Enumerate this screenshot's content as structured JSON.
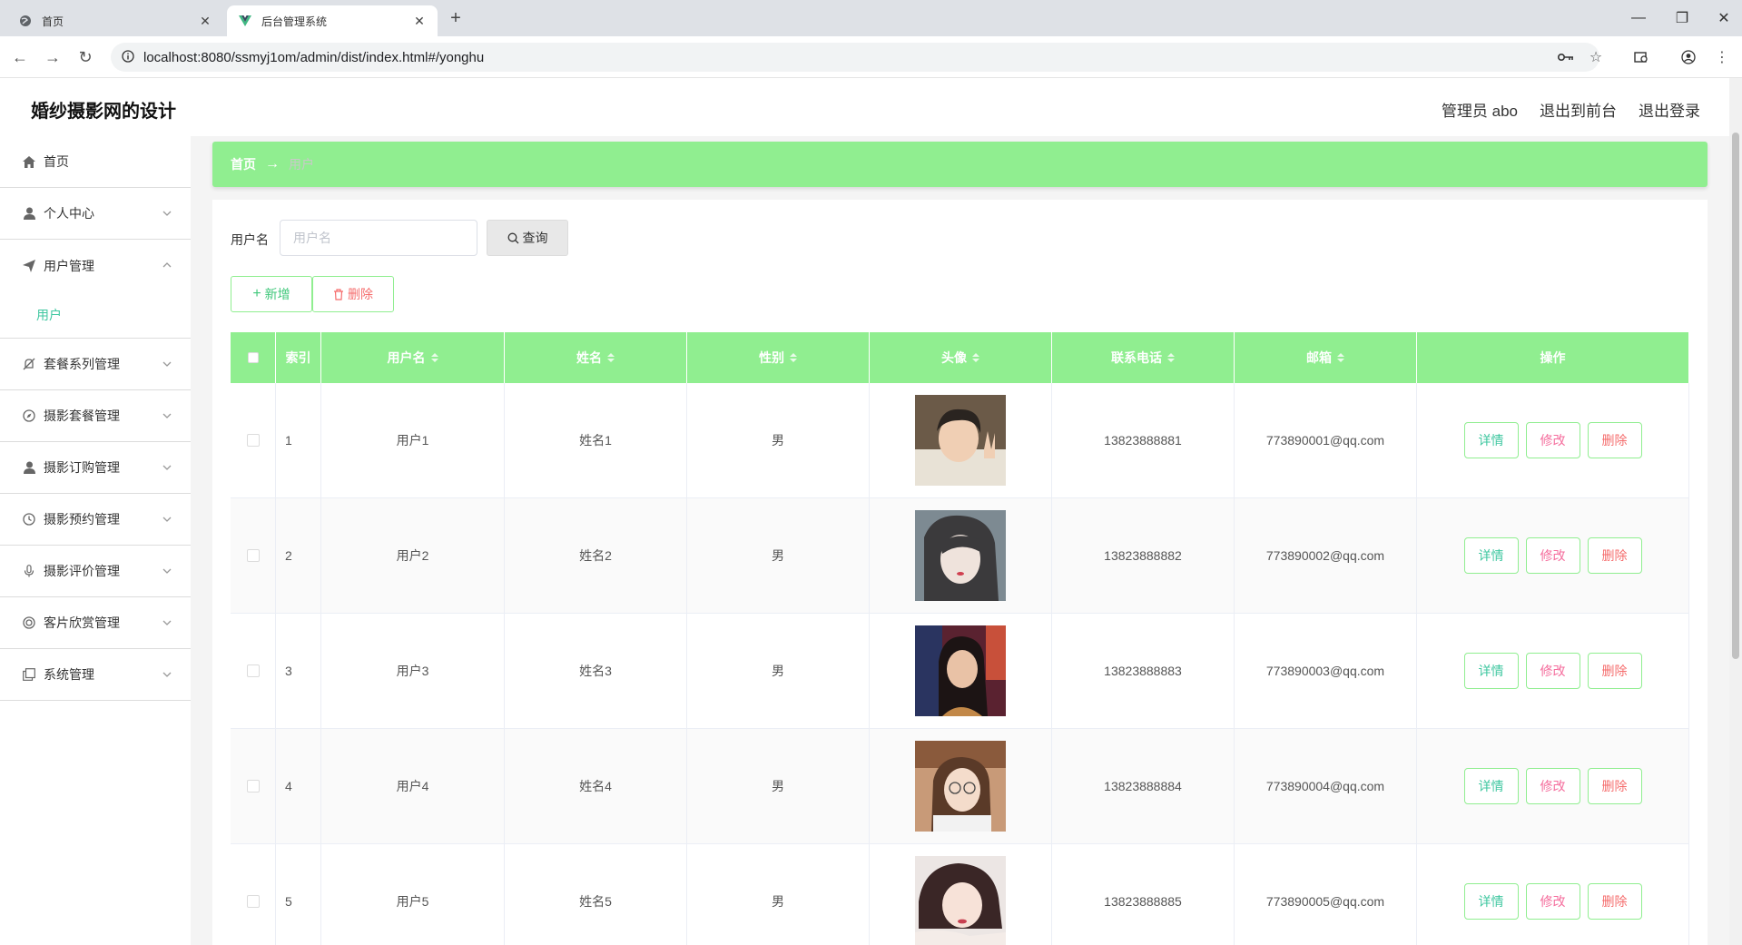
{
  "browser": {
    "tabs": [
      {
        "title": "首页",
        "active": false
      },
      {
        "title": "后台管理系统",
        "active": true
      }
    ],
    "url": "localhost:8080/ssmyj1om/admin/dist/index.html#/yonghu"
  },
  "header": {
    "title": "婚纱摄影网的设计",
    "links": [
      "管理员 abo",
      "退出到前台",
      "退出登录"
    ]
  },
  "sidebar": {
    "items": [
      {
        "label": "首页",
        "icon": "home-icon",
        "expandable": false
      },
      {
        "label": "个人中心",
        "icon": "user-icon",
        "expandable": true
      },
      {
        "label": "用户管理",
        "icon": "send-icon",
        "expandable": true,
        "expanded": true,
        "children": [
          "用户"
        ]
      },
      {
        "label": "套餐系列管理",
        "icon": "bell-off-icon",
        "expandable": true
      },
      {
        "label": "摄影套餐管理",
        "icon": "compass-icon",
        "expandable": true
      },
      {
        "label": "摄影订购管理",
        "icon": "user-icon",
        "expandable": true
      },
      {
        "label": "摄影预约管理",
        "icon": "clock-icon",
        "expandable": true
      },
      {
        "label": "摄影评价管理",
        "icon": "microphone-icon",
        "expandable": true
      },
      {
        "label": "客片欣赏管理",
        "icon": "circle-icon",
        "expandable": true
      },
      {
        "label": "系统管理",
        "icon": "copy-icon",
        "expandable": true
      }
    ]
  },
  "breadcrumb": {
    "home": "首页",
    "arrow": "→",
    "current": "用户"
  },
  "search": {
    "label": "用户名",
    "placeholder": "用户名",
    "value": "",
    "button": "查询"
  },
  "actions": {
    "add": "新增",
    "delete": "删除"
  },
  "table": {
    "columns": [
      "",
      "索引",
      "用户名",
      "姓名",
      "性别",
      "头像",
      "联系电话",
      "邮箱",
      "操作"
    ],
    "rows": [
      {
        "index": "1",
        "username": "用户1",
        "name": "姓名1",
        "gender": "男",
        "phone": "13823888881",
        "email": "773890001@qq.com"
      },
      {
        "index": "2",
        "username": "用户2",
        "name": "姓名2",
        "gender": "男",
        "phone": "13823888882",
        "email": "773890002@qq.com"
      },
      {
        "index": "3",
        "username": "用户3",
        "name": "姓名3",
        "gender": "男",
        "phone": "13823888883",
        "email": "773890003@qq.com"
      },
      {
        "index": "4",
        "username": "用户4",
        "name": "姓名4",
        "gender": "男",
        "phone": "13823888884",
        "email": "773890004@qq.com"
      },
      {
        "index": "5",
        "username": "用户5",
        "name": "姓名5",
        "gender": "男",
        "phone": "13823888885",
        "email": "773890005@qq.com"
      }
    ],
    "row_actions": [
      "详情",
      "修改",
      "删除"
    ]
  },
  "colors": {
    "accent": "#90ee90",
    "active_menu": "#3fc7a0",
    "danger": "#f56c6c"
  }
}
